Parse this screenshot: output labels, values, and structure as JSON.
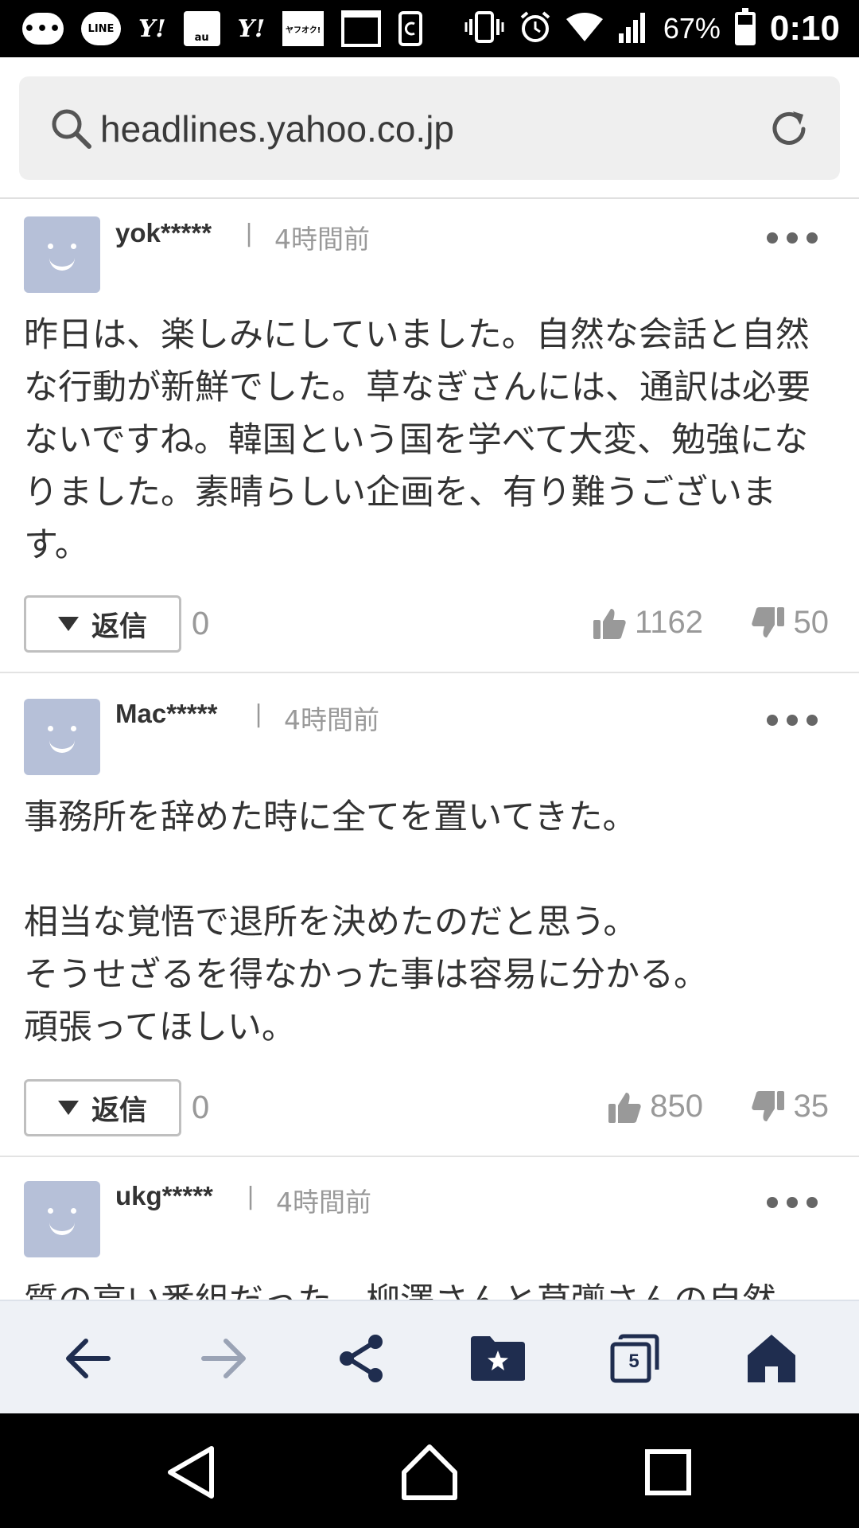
{
  "status_bar": {
    "battery_percent": "67%",
    "time": "0:10",
    "notification_icons": [
      "chat-icon",
      "line-icon",
      "yahoo-icon",
      "au-mail-icon",
      "yahoo-icon",
      "yafuoku-icon",
      "calendar-icon",
      "clipboard-icon"
    ],
    "line_label": "LINE",
    "yahoo_label": "Y!",
    "au_label": "au",
    "yafuoku_label": "ヤフオク!"
  },
  "url_bar": {
    "url": "headlines.yahoo.co.jp"
  },
  "comments": [
    {
      "user": "yok*****",
      "separator": "|",
      "time": "4時間前",
      "body": "昨日は、楽しみにしていました。自然な会話と自然な行動が新鮮でした。草なぎさんには、通訳は必要ないですね。韓国という国を学べて大変、勉強になりました。素晴らしい企画を、有り難うございます。",
      "reply_label": "返信",
      "reply_count": "0",
      "likes": "1162",
      "dislikes": "50"
    },
    {
      "user": "Mac*****",
      "separator": "|",
      "time": "4時間前",
      "body": "事務所を辞めた時に全てを置いてきた。\n\n相当な覚悟で退所を決めたのだと思う。\nそうせざるを得なかった事は容易に分かる。\n頑張ってほしい。",
      "reply_label": "返信",
      "reply_count": "0",
      "likes": "850",
      "dislikes": "35"
    },
    {
      "user": "ukg*****",
      "separator": "|",
      "time": "4時間前",
      "body": "質の高い番組だった。柳澤さんと草彅さんの自然"
    }
  ],
  "toolbar": {
    "tab_count": "5",
    "icons": [
      "back-arrow-icon",
      "forward-arrow-icon",
      "share-icon",
      "bookmark-folder-icon",
      "tabs-icon",
      "home-icon"
    ],
    "accent_color": "#1f2d4f"
  },
  "nav_bar": {
    "icons": [
      "nav-back-icon",
      "nav-home-icon",
      "nav-recents-icon"
    ]
  },
  "colors": {
    "avatar": "#b6c0d8",
    "muted_text": "#999999",
    "body_text": "#333333"
  }
}
